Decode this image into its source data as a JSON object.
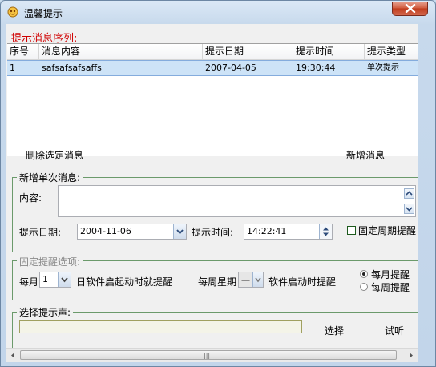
{
  "window": {
    "title": "温馨提示"
  },
  "messages": {
    "section_title": "提示消息序列:",
    "columns": [
      "序号",
      "消息内容",
      "提示日期",
      "提示时间",
      "提示类型"
    ],
    "rows": [
      {
        "index": "1",
        "content": "safsafsafsaffs",
        "date": "2007-04-05",
        "time": "19:30:44",
        "type": "单次提示"
      }
    ],
    "delete_label": "删除选定消息",
    "add_label": "新增消息"
  },
  "single": {
    "group_label": "新增单次消息:",
    "content_label": "内容:",
    "content_value": "",
    "date_label": "提示日期:",
    "date_value": "2004-11-06",
    "time_label": "提示时间:",
    "time_value": "14:22:41",
    "fixed_label": "固定周期提醒",
    "fixed_checked": false
  },
  "fixed": {
    "group_label": "固定提醒选项:",
    "monthly_prefix": "每月",
    "monthly_value": "1",
    "monthly_suffix": "日软件启起动时就提醒",
    "weekly_prefix": "每周星期",
    "weekly_value": "一",
    "weekly_suffix": "软件启动时提醒",
    "option_monthly": "每月提醒",
    "option_weekly": "每周提醒",
    "selected": "每月提醒"
  },
  "sound": {
    "group_label": "选择提示声:",
    "path_value": "",
    "select_label": "选择",
    "test_label": "试听"
  },
  "colors": {
    "section_title": "#d00000",
    "group_border": "#6b9a6b",
    "selected_row": "#cde3f7"
  }
}
